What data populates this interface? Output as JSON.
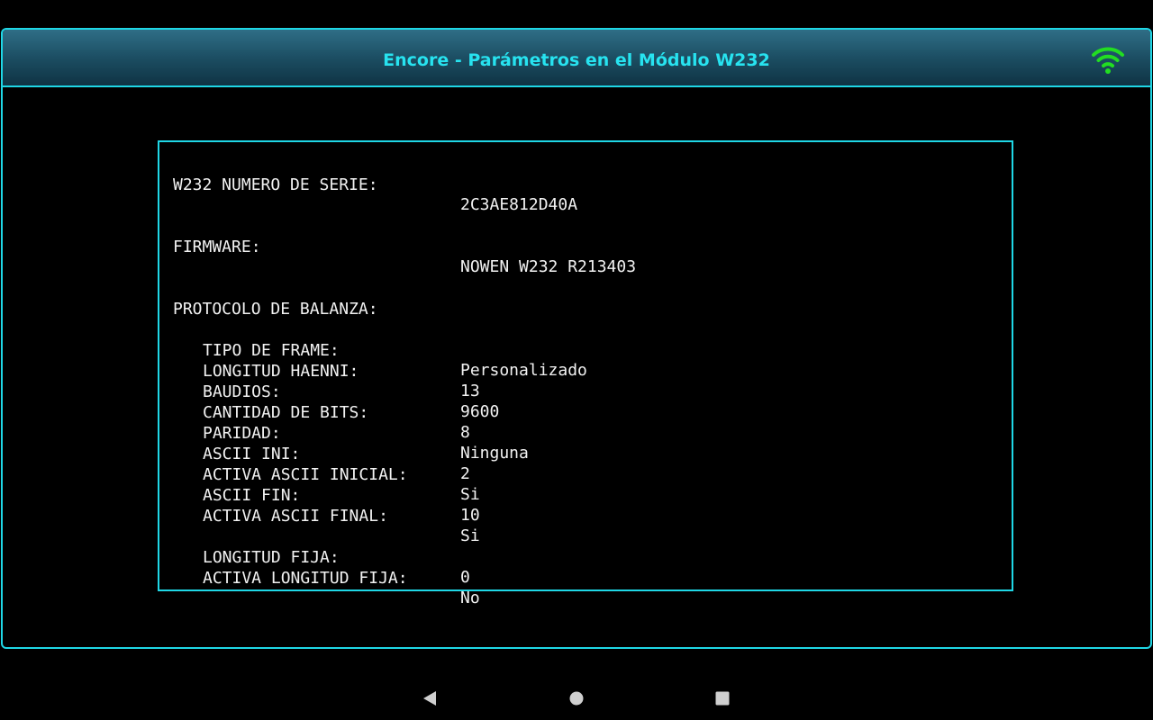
{
  "title_bar": {
    "title": "Encore - Parámetros en el Módulo W232",
    "icon": "wifi-icon",
    "icon_color": "#22dd22"
  },
  "colors": {
    "accent": "#1fd7e6",
    "title_text": "#27e3f0",
    "text": "#f2f2f2",
    "background": "#000000"
  },
  "params": {
    "serial": {
      "label": "W232 NUMERO DE SERIE:",
      "value": "2C3AE812D40A"
    },
    "firmware": {
      "label": "FIRMWARE:",
      "value": "NOWEN W232 R213403"
    },
    "protocol_heading": "PROTOCOLO DE BALANZA:",
    "protocol": [
      {
        "label": "TIPO DE FRAME:",
        "value": "Personalizado"
      },
      {
        "label": "LONGITUD HAENNI:",
        "value": "13"
      },
      {
        "label": "BAUDIOS:",
        "value": "9600"
      },
      {
        "label": "CANTIDAD DE BITS:",
        "value": "8"
      },
      {
        "label": "PARIDAD:",
        "value": "Ninguna"
      },
      {
        "label": "ASCII INI:",
        "value": "2"
      },
      {
        "label": "ACTIVA ASCII INICIAL:",
        "value": "Si"
      },
      {
        "label": "ASCII FIN:",
        "value": "10"
      },
      {
        "label": "ACTIVA ASCII FINAL:",
        "value": "Si"
      }
    ],
    "fixed_length": [
      {
        "label": "LONGITUD FIJA:",
        "value": "0"
      },
      {
        "label": "ACTIVA LONGITUD FIJA:",
        "value": "No"
      }
    ]
  },
  "nav_bar": {
    "back_icon": "back-triangle-icon",
    "home_icon": "home-circle-icon",
    "recents_icon": "recents-square-icon"
  }
}
